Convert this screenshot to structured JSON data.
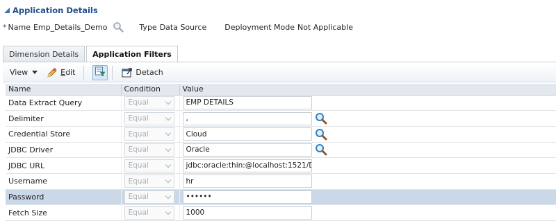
{
  "section": {
    "title": "Application Details"
  },
  "details": {
    "required_marker": "*",
    "name_label": "Name",
    "name_value": "Emp_Details_Demo",
    "type_label": "Type",
    "type_value": "Data Source",
    "deployment_label": "Deployment Mode",
    "deployment_value": "Not Applicable"
  },
  "tabs": [
    {
      "label": "Dimension Details",
      "active": false
    },
    {
      "label": "Application Filters",
      "active": true
    }
  ],
  "toolbar": {
    "view_label": "View",
    "edit_label_first": "E",
    "edit_label_rest": "dit",
    "detach_label": "Detach"
  },
  "table": {
    "columns": [
      "Name",
      "Condition",
      "Value"
    ],
    "rows": [
      {
        "name": "Data Extract Query",
        "condition": "Equal",
        "value": "EMP DETAILS",
        "search": false,
        "selected": false
      },
      {
        "name": "Delimiter",
        "condition": "Equal",
        "value": ",",
        "search": true,
        "selected": false
      },
      {
        "name": "Credential Store",
        "condition": "Equal",
        "value": "Cloud",
        "search": true,
        "selected": false
      },
      {
        "name": "JDBC Driver",
        "condition": "Equal",
        "value": "Oracle",
        "search": true,
        "selected": false
      },
      {
        "name": "JDBC URL",
        "condition": "Equal",
        "value": "jdbc:oracle:thin:@localhost:1521/D",
        "search": false,
        "selected": false
      },
      {
        "name": "Username",
        "condition": "Equal",
        "value": "hr",
        "search": false,
        "selected": false
      },
      {
        "name": "Password",
        "condition": "Equal",
        "value": "••••••",
        "search": false,
        "selected": true
      },
      {
        "name": "Fetch Size",
        "condition": "Equal",
        "value": "1000",
        "search": false,
        "selected": false
      }
    ]
  },
  "colors": {
    "accent": "#1f4e8c",
    "selected_row": "#cad8e8",
    "header_bg": "#e3e8ee"
  }
}
